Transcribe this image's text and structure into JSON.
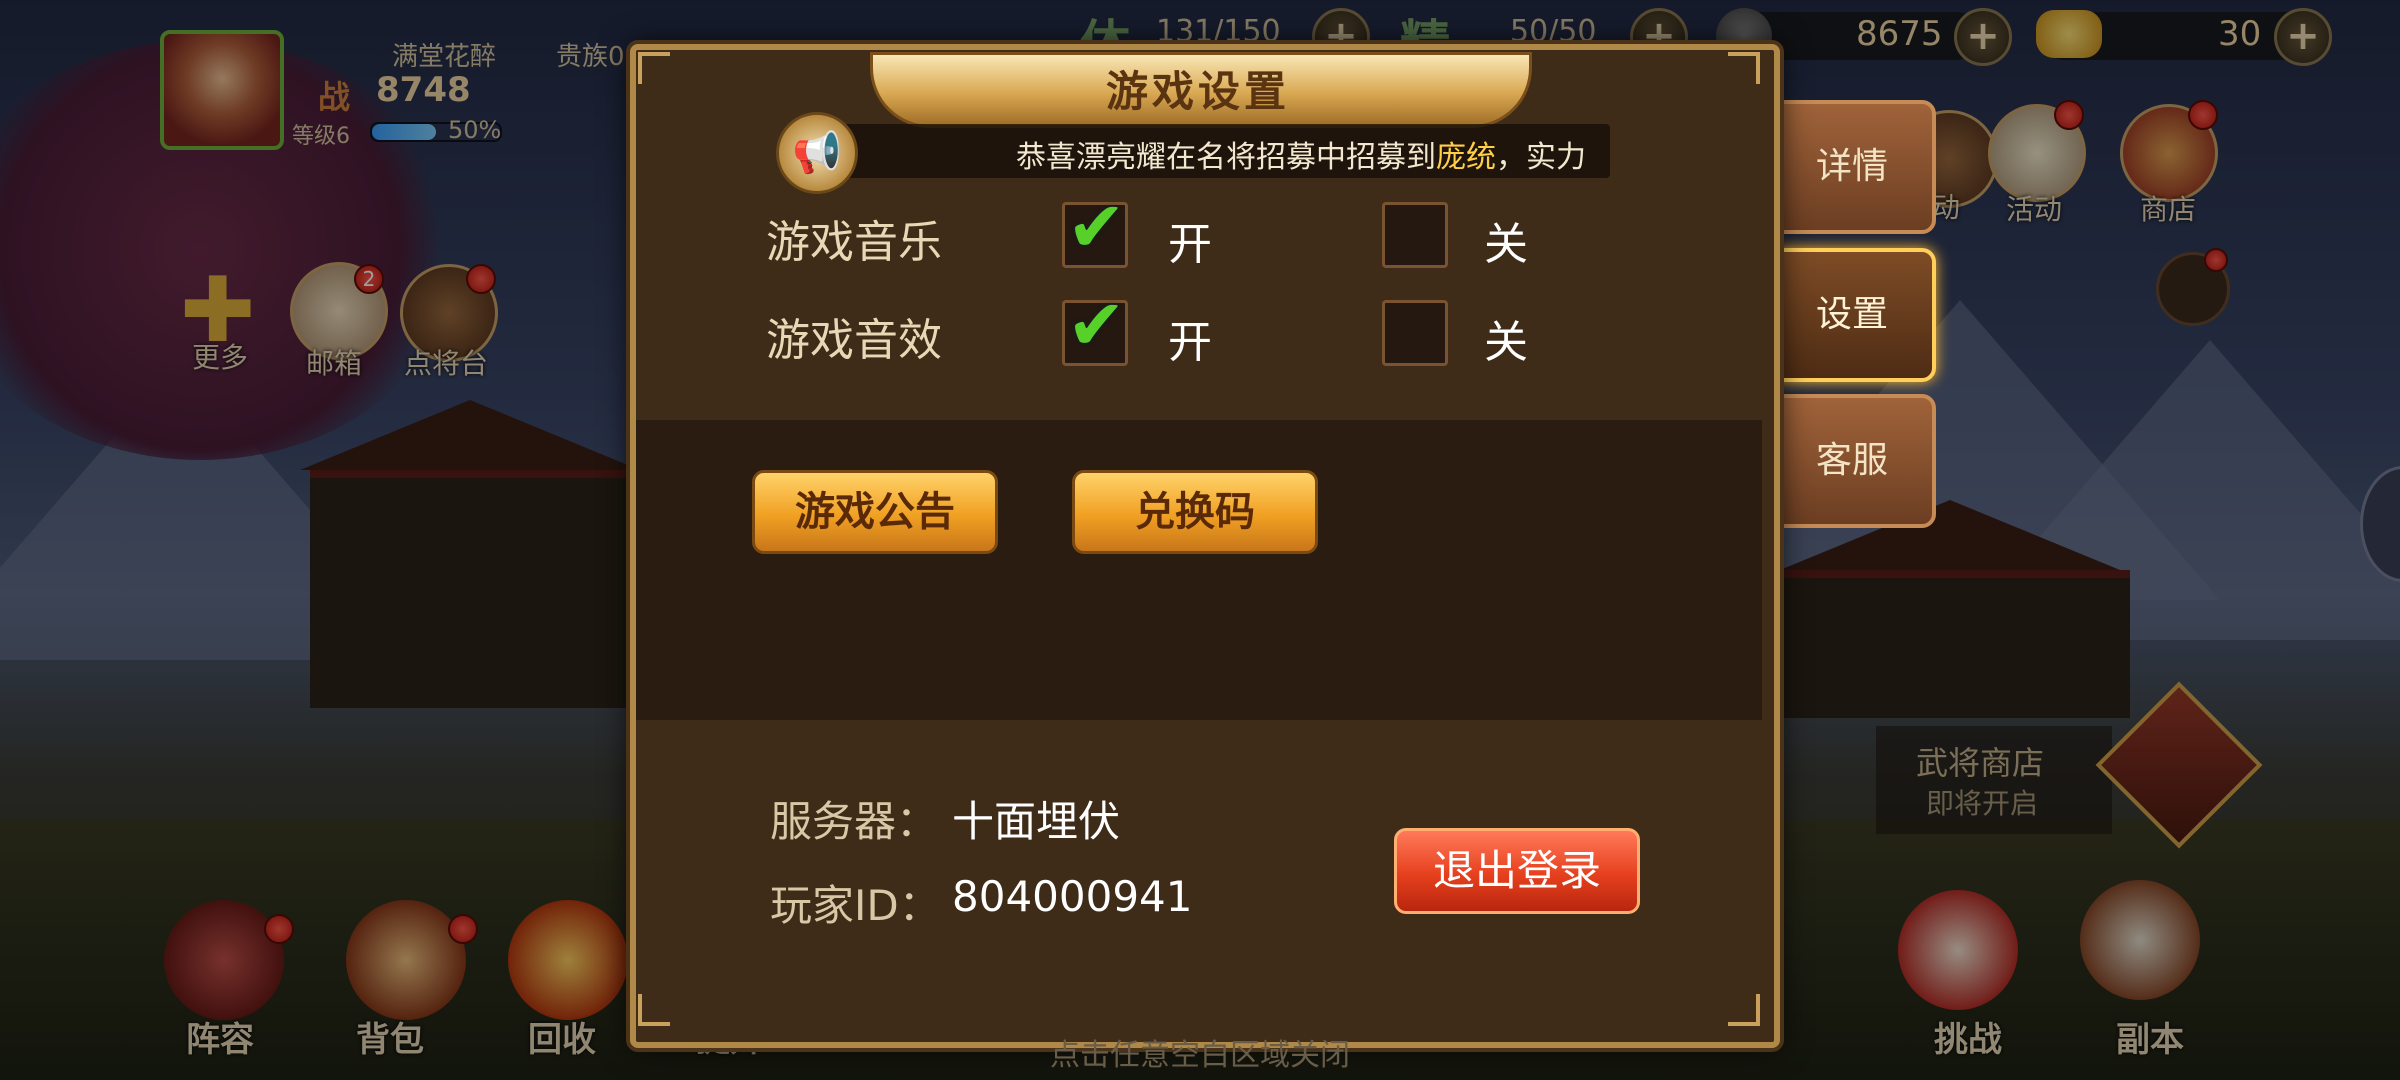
{
  "player": {
    "name": "满堂花醉",
    "vip": "贵族0",
    "power_label": "战",
    "power": "8748",
    "level": "等级6",
    "exp_percent_label": "50%",
    "exp_fraction": 0.5
  },
  "resources": {
    "stamina_label": "体",
    "stamina": "131/150",
    "energy_label": "精",
    "energy": "50/50",
    "coins": "8675",
    "gold": "30"
  },
  "left_icons": [
    {
      "label": "更多"
    },
    {
      "label": "邮箱",
      "badge": "2"
    },
    {
      "label": "点将台"
    }
  ],
  "top_right_icons": [
    {
      "label": "活动"
    },
    {
      "label": "活动"
    },
    {
      "label": "商店"
    }
  ],
  "side_tabs": [
    {
      "label": "详情",
      "active": false
    },
    {
      "label": "设置",
      "active": true
    },
    {
      "label": "客服",
      "active": false
    }
  ],
  "shop_notice": {
    "line1": "武将商店",
    "line2": "即将开启"
  },
  "bottom_nav": [
    {
      "label": "阵容"
    },
    {
      "label": "背包"
    },
    {
      "label": "回收"
    },
    {
      "label": "提升"
    },
    {
      "label": "挑战"
    },
    {
      "label": "副本"
    }
  ],
  "dialog": {
    "title": "游戏设置",
    "marquee_prefix": "恭喜漂亮耀在名将招募中招募到",
    "marquee_highlight": "庞统",
    "marquee_suffix": "，实力",
    "music_label": "游戏音乐",
    "sfx_label": "游戏音效",
    "on_label": "开",
    "off_label": "关",
    "music_on": true,
    "sfx_on": true,
    "announcement_button": "游戏公告",
    "redeem_button": "兑换码",
    "server_label": "服务器：",
    "server_value": "十面埋伏",
    "player_id_label": "玩家ID：",
    "player_id_value": "804000941",
    "logout_button": "退出登录"
  },
  "close_hint": "点击任意空白区域关闭",
  "colors": {
    "dialog_bg": "#3e2b18",
    "dialog_border": "#b08848",
    "gold_button": "#f0a022",
    "red_button": "#e6401e",
    "check_green": "#58d02a",
    "highlight_text": "#ffcf4a"
  }
}
